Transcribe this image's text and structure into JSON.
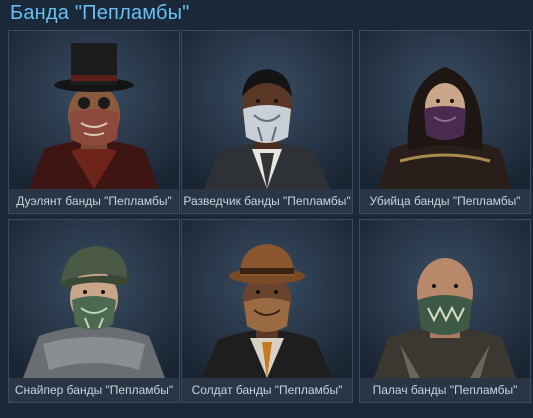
{
  "section": {
    "title": "Банда \"Пепламбы\""
  },
  "cards": [
    {
      "label": "Дуэлянт банды \"Пепламбы\"",
      "portrait": "duelist-portrait"
    },
    {
      "label": "Разведчик банды \"Пепламбы\"",
      "portrait": "scout-portrait"
    },
    {
      "label": "Убийца банды \"Пепламбы\"",
      "portrait": "assassin-portrait"
    },
    {
      "label": "Снайпер банды \"Пепламбы\"",
      "portrait": "sniper-portrait"
    },
    {
      "label": "Солдат банды \"Пепламбы\"",
      "portrait": "soldier-portrait"
    },
    {
      "label": "Палач банды \"Пепламбы\"",
      "portrait": "executioner-portrait"
    }
  ],
  "colors": {
    "background": "#1b2838",
    "title": "#66c0f4",
    "card_bg": "#202d3c",
    "caption_bg": "#2a3646",
    "caption_text": "#c6d4df"
  }
}
